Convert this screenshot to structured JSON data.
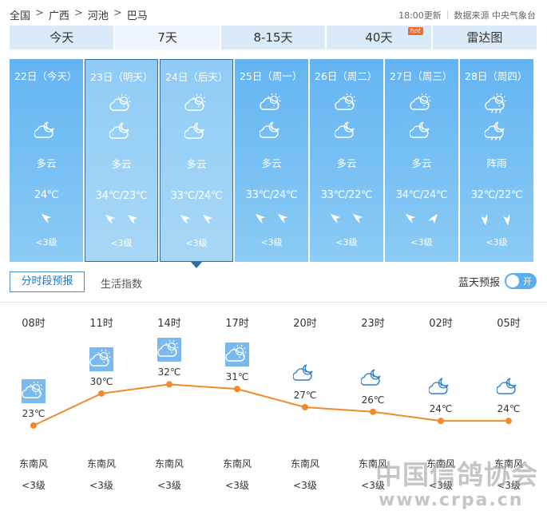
{
  "breadcrumb": [
    "全国",
    "广西",
    "河池",
    "巴马"
  ],
  "breadcrumb_sep": ">",
  "update_time": "18:00更新",
  "source": "数据来源 中央气象台",
  "tabs": [
    {
      "label": "今天",
      "active": false
    },
    {
      "label": "7天",
      "active": true
    },
    {
      "label": "8-15天",
      "active": false
    },
    {
      "label": "40天",
      "active": false,
      "badge": "hot"
    },
    {
      "label": "雷达图",
      "active": false
    }
  ],
  "days": [
    {
      "date": "22日（今天）",
      "icons": [
        "none",
        "partly-cloudy-night"
      ],
      "desc": "多云",
      "temp": "24℃",
      "winds": [
        "ne"
      ],
      "level": "<3级",
      "selected": false
    },
    {
      "date": "23日（明天）",
      "icons": [
        "partly-cloudy-day",
        "partly-cloudy-night"
      ],
      "desc": "多云",
      "temp": "34℃/23℃",
      "winds": [
        "ne",
        "ne"
      ],
      "level": "<3级",
      "selected": true
    },
    {
      "date": "24日（后天）",
      "icons": [
        "partly-cloudy-day",
        "partly-cloudy-night"
      ],
      "desc": "多云",
      "temp": "33℃/24℃",
      "winds": [
        "ne",
        "ne"
      ],
      "level": "<3级",
      "selected": true
    },
    {
      "date": "25日（周一）",
      "icons": [
        "partly-cloudy-day",
        "partly-cloudy-night"
      ],
      "desc": "多云",
      "temp": "33℃/24℃",
      "winds": [
        "ne",
        "ne"
      ],
      "level": "<3级",
      "selected": false
    },
    {
      "date": "26日（周二）",
      "icons": [
        "partly-cloudy-day",
        "partly-cloudy-night"
      ],
      "desc": "多云",
      "temp": "33℃/22℃",
      "winds": [
        "ne",
        "ne"
      ],
      "level": "<3级",
      "selected": false
    },
    {
      "date": "27日（周三）",
      "icons": [
        "partly-cloudy-day",
        "partly-cloudy-night"
      ],
      "desc": "多云",
      "temp": "34℃/24℃",
      "winds": [
        "ne",
        "nw"
      ],
      "level": "<3级",
      "selected": false
    },
    {
      "date": "28日（周四）",
      "icons": [
        "shower-day",
        "shower-night"
      ],
      "desc": "阵雨",
      "temp": "32℃/22℃",
      "winds": [
        "s",
        "s"
      ],
      "level": "<3级",
      "selected": false
    }
  ],
  "subtabs": {
    "hourly": "分时段预报",
    "life": "生活指数"
  },
  "blue_sky": {
    "label": "蓝天预报",
    "toggle": "开"
  },
  "hourly": {
    "times": [
      "08时",
      "11时",
      "14时",
      "17时",
      "20时",
      "23时",
      "02时",
      "05时"
    ],
    "temps": [
      23,
      30,
      32,
      31,
      27,
      26,
      24,
      24
    ],
    "temp_labels": [
      "23℃",
      "30℃",
      "32℃",
      "31℃",
      "27℃",
      "26℃",
      "24℃",
      "24℃"
    ],
    "icons": [
      "sun-cloud",
      "sun-cloud",
      "sun-cloud",
      "sun-cloud",
      "moon-cloud",
      "moon-cloud",
      "moon-cloud",
      "moon-cloud"
    ],
    "winds": [
      "东南风",
      "东南风",
      "东南风",
      "东南风",
      "东南风",
      "东南风",
      "东南风",
      "东南风"
    ],
    "levels": [
      "<3级",
      "<3级",
      "<3级",
      "<3级",
      "<3级",
      "<3级",
      "<3级",
      "<3级"
    ],
    "line_color": "#f08a2a"
  },
  "watermark": {
    "text": "中国信鸽协会",
    "url": "www.crpa.cn"
  }
}
